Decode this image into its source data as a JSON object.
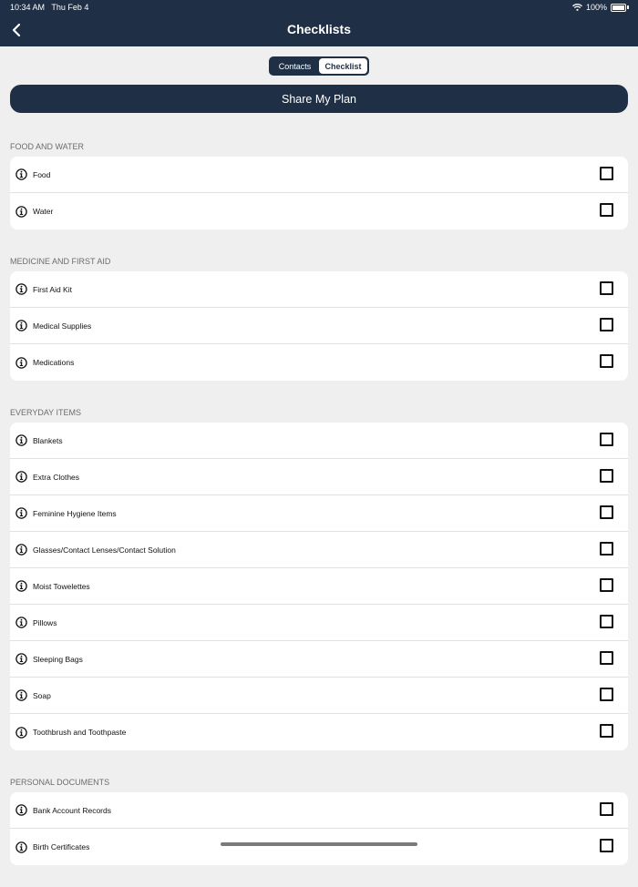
{
  "status_bar": {
    "time": "10:34 AM",
    "date": "Thu Feb 4",
    "battery": "100%"
  },
  "nav": {
    "title": "Checklists"
  },
  "segments": {
    "contacts": "Contacts",
    "checklist": "Checklist",
    "selected": "Checklist"
  },
  "share_button": "Share My Plan",
  "sections": [
    {
      "title": "FOOD AND WATER",
      "items": [
        "Food",
        "Water"
      ]
    },
    {
      "title": "MEDICINE AND FIRST AID",
      "items": [
        "First Aid Kit",
        "Medical Supplies",
        "Medications"
      ]
    },
    {
      "title": "EVERYDAY ITEMS",
      "items": [
        "Blankets",
        "Extra Clothes",
        "Feminine Hygiene Items",
        "Glasses/Contact Lenses/Contact Solution",
        "Moist Towelettes",
        "Pillows",
        "Sleeping Bags",
        "Soap",
        "Toothbrush and Toothpaste"
      ]
    },
    {
      "title": "PERSONAL DOCUMENTS",
      "items": [
        "Bank Account Records",
        "Birth Certificates"
      ]
    }
  ]
}
